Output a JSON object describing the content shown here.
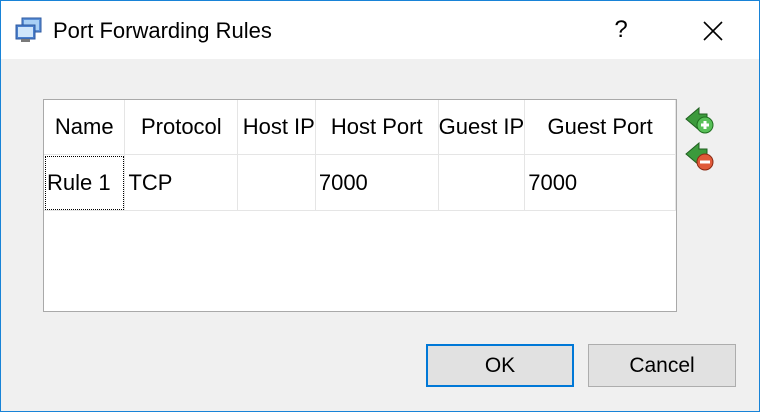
{
  "window": {
    "title": "Port Forwarding Rules",
    "help_label": "?",
    "icon": "network-computer-icon",
    "accent_color": "#1883d7"
  },
  "table": {
    "columns": [
      "Name",
      "Protocol",
      "Host IP",
      "Host Port",
      "Guest IP",
      "Guest Port"
    ],
    "rows": [
      {
        "name": "Rule 1",
        "protocol": "TCP",
        "host_ip": "",
        "host_port": "7000",
        "guest_ip": "",
        "guest_port": "7000"
      }
    ]
  },
  "side_buttons": {
    "add": "add-rule-icon",
    "remove": "remove-rule-icon"
  },
  "buttons": {
    "ok": "OK",
    "cancel": "Cancel"
  }
}
